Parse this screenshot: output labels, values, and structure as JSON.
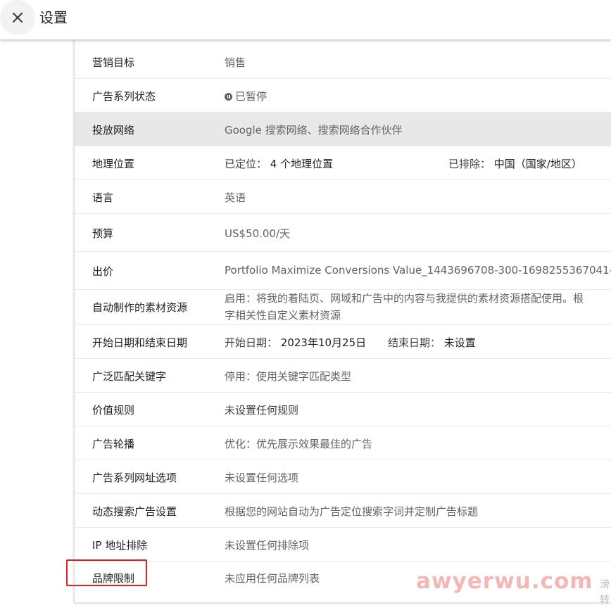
{
  "header": {
    "title": "设置"
  },
  "rows": [
    {
      "label": "营销目标",
      "value": "销售"
    },
    {
      "label": "广告系列状态",
      "value": "已暂停"
    },
    {
      "label": "投放网络",
      "value": "Google 搜索网络、搜索网络合作伙伴"
    },
    {
      "label": "地理位置",
      "targeted_label": "已定位：",
      "targeted_value": "4 个地理位置",
      "excluded_label": "已排除：",
      "excluded_value": "中国（国家/地区）"
    },
    {
      "label": "语言",
      "value": "英语"
    },
    {
      "label": "预算",
      "value": "US$50.00/天"
    },
    {
      "label": "出价",
      "value": "Portfolio Maximize Conversions Value_1443696708-300-1698255367041-"
    },
    {
      "label": "自动制作的素材资源",
      "value": "启用：将我的着陆页、网域和广告中的内容与我提供的素材资源搭配使用。根",
      "value_line2": "字相关性自定义素材资源"
    },
    {
      "label": "开始日期和结束日期",
      "start_label": "开始日期：",
      "start_value": "2023年10月25日",
      "end_label": "结束日期：",
      "end_value": "未设置"
    },
    {
      "label": "广泛匹配关键字",
      "value": "停用：使用关键字匹配类型"
    },
    {
      "label": "价值规则",
      "value": "未设置任何规则"
    },
    {
      "label": "广告轮播",
      "value": "优化：优先展示效果最佳的广告"
    },
    {
      "label": "广告系列网址选项",
      "value": "未设置任何选项"
    },
    {
      "label": "动态搜索广告设置",
      "value": "根据您的网站自动为广告定位搜索字词并定制广告标题"
    },
    {
      "label": "IP 地址排除",
      "value": "未设置任何排除项"
    },
    {
      "label": "品牌限制",
      "value": "未应用任何品牌列表"
    }
  ],
  "watermark": {
    "text": "awyerwu.com",
    "side_text": "滂转"
  },
  "icons": {
    "close": "close-icon",
    "status": "pause-circle-icon"
  },
  "colors": {
    "highlight_row": "#e8e8e8",
    "annotation_box": "#e02020",
    "watermark": "#f2aaaa"
  }
}
